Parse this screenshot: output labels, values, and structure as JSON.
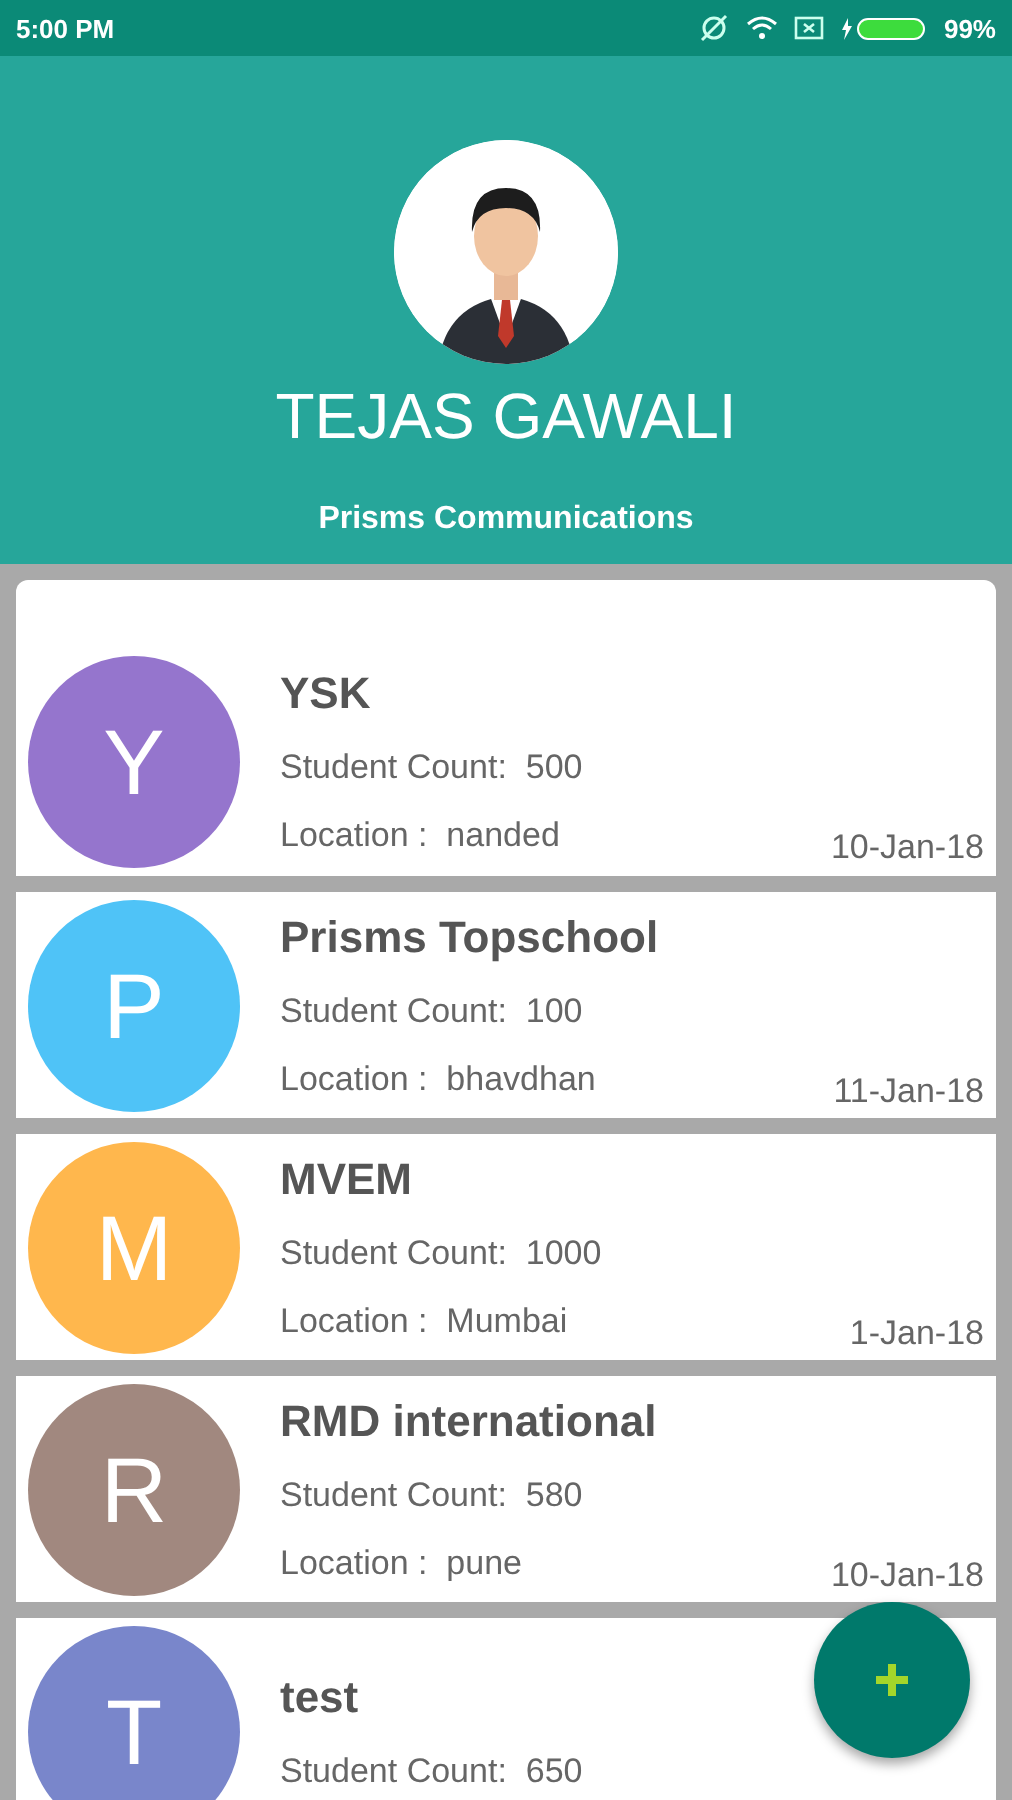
{
  "status_bar": {
    "time": "5:00 PM",
    "battery": "99%"
  },
  "profile": {
    "name": "TEJAS GAWALI",
    "organization": "Prisms Communications"
  },
  "schools": [
    {
      "initial": "Y",
      "color": "#9575cd",
      "name": "YSK",
      "student_count": "Student Count:  500",
      "location": "Location :  nanded",
      "date": "10-Jan-18"
    },
    {
      "initial": "P",
      "color": "#4fc3f7",
      "name": "Prisms Topschool",
      "student_count": "Student Count:  100",
      "location": "Location :  bhavdhan",
      "date": "11-Jan-18"
    },
    {
      "initial": "M",
      "color": "#ffb74d",
      "name": "MVEM",
      "student_count": "Student Count:  1000",
      "location": "Location :  Mumbai",
      "date": "1-Jan-18"
    },
    {
      "initial": "R",
      "color": "#a1887f",
      "name": "RMD international",
      "student_count": "Student Count:  580",
      "location": "Location :  pune",
      "date": "10-Jan-18"
    },
    {
      "initial": "T",
      "color": "#7986cb",
      "name": "test",
      "student_count": "Student Count:  650"
    }
  ]
}
